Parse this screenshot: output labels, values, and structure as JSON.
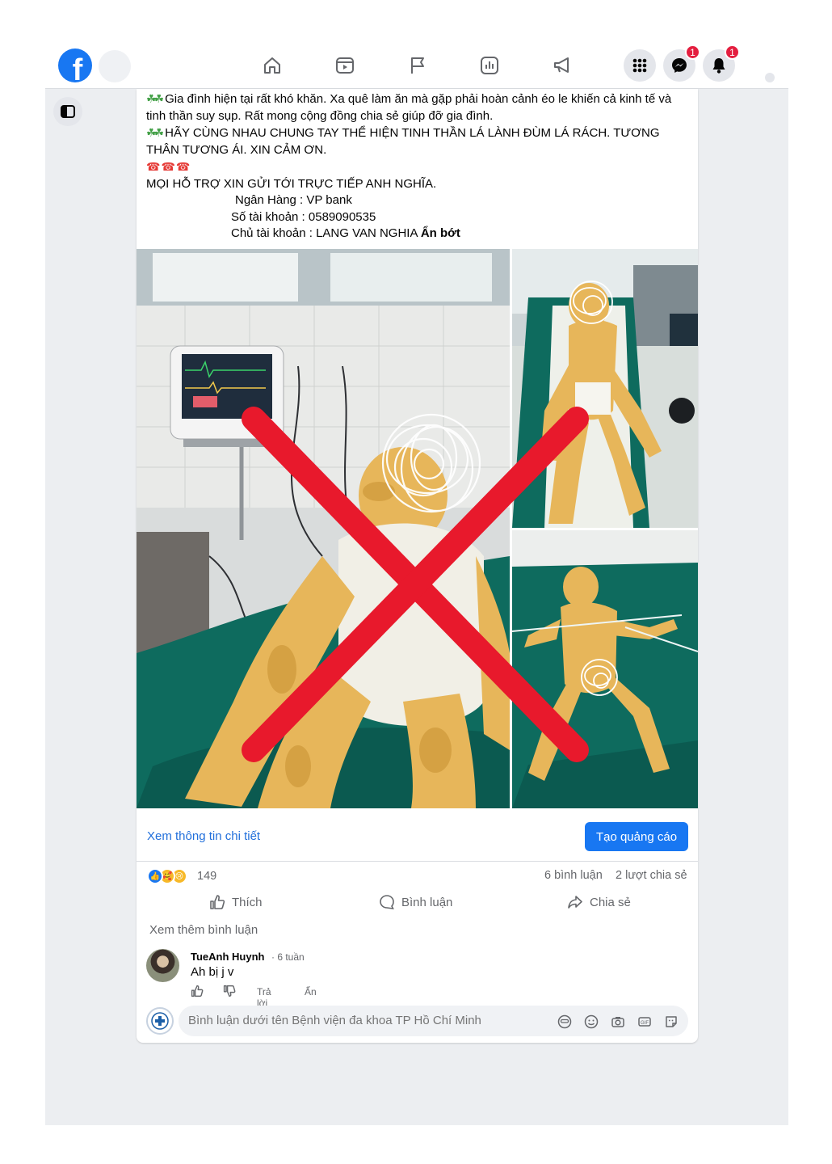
{
  "nav": {
    "logo_letter": "f",
    "messenger_badge": "1",
    "notifications_badge": "1"
  },
  "post": {
    "lines": [
      "Gia đình hiện tại rất khó khăn. Xa quê làm ăn mà gặp phải hoàn cảnh éo le khiến cả kinh tế và",
      "tinh thần suy sụp. Rất mong cộng đồng chia sẻ giúp đỡ gia đình.",
      "HÃY CÙNG NHAU CHUNG TAY THỂ HIỆN TINH THẦN LÁ LÀNH ĐÙM LÁ RÁCH. TƯƠNG",
      "THÂN TƯƠNG ÁI. XIN CẢM ƠN.",
      "MỌI HỖ TRỢ XIN GỬI TỚI TRỰC TIẾP ANH NGHĨA.",
      "Ngân Hàng : VP bank",
      "Số tài khoản : 0589090535",
      "Chủ tài khoản : LANG VAN NGHIA"
    ],
    "see_less": "Ẩn bớt"
  },
  "cta": {
    "link": "Xem thông tin chi tiết",
    "button": "Tạo quảng cáo"
  },
  "stats": {
    "reactions": "149",
    "comments": "6 bình luận",
    "shares": "2 lượt chia sẻ"
  },
  "actions": {
    "like": "Thích",
    "comment": "Bình luận",
    "share": "Chia sẻ"
  },
  "comments": {
    "more": "Xem thêm bình luận",
    "items": [
      {
        "author": "TueAnh Huynh",
        "time": "· 6 tuần",
        "text": "Ah bị j v",
        "reply": "Trả lời",
        "hide": "Ẩn"
      }
    ]
  },
  "composer": {
    "placeholder": "Bình luận dưới tên Bệnh viện đa khoa TP Hồ Chí Minh"
  },
  "colors": {
    "brand": "#1877f2",
    "badge": "#e41e3f",
    "cross": "#e8192c",
    "hospital_sheet": "#0e6b5e",
    "bandage": "#e7b65a"
  }
}
